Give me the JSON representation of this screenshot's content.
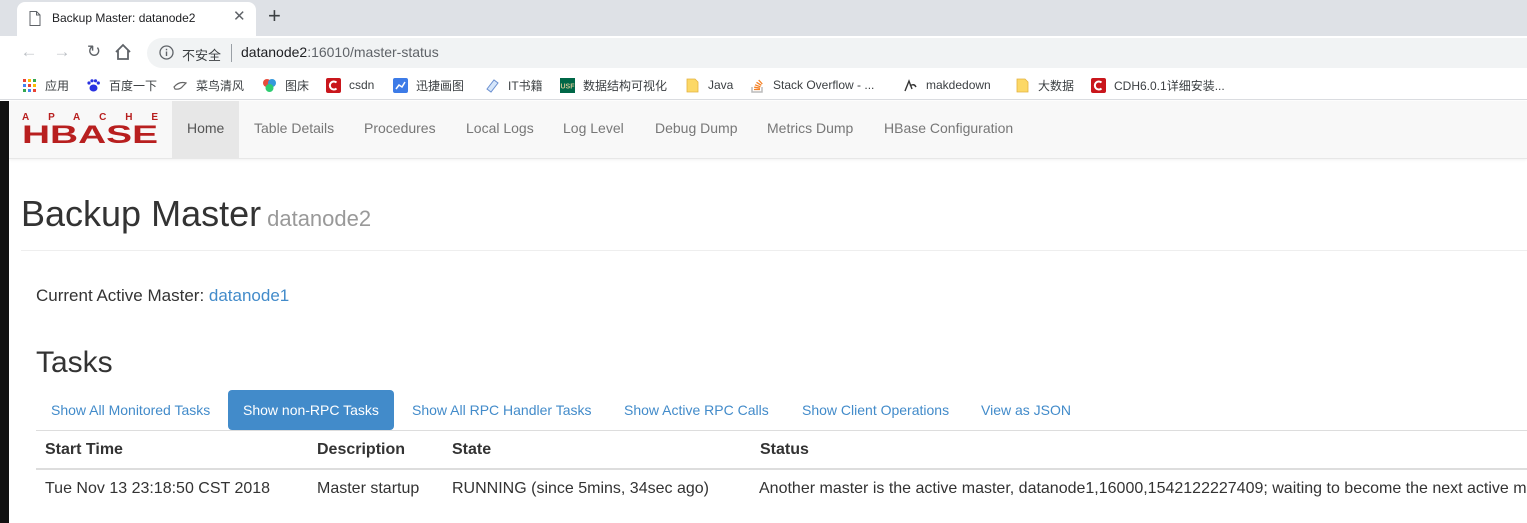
{
  "browser": {
    "tab_title": "Backup Master: datanode2",
    "insecure_label": "不安全",
    "url_host": "datanode2",
    "url_rest": ":16010/master-status",
    "bookmarks": [
      {
        "label": "应用",
        "icon": "apps-grid-icon"
      },
      {
        "label": "百度一下",
        "icon": "baidu-paw-icon"
      },
      {
        "label": "菜鸟清风",
        "icon": "bird-icon"
      },
      {
        "label": "图床",
        "icon": "image-bed-icon"
      },
      {
        "label": "csdn",
        "icon": "csdn-icon"
      },
      {
        "label": "迅捷画图",
        "icon": "xunjie-icon"
      },
      {
        "label": "IT书籍",
        "icon": "book-icon"
      },
      {
        "label": "数据结构可视化",
        "icon": "usf-icon"
      },
      {
        "label": "Java",
        "icon": "folder-icon"
      },
      {
        "label": "Stack Overflow - ...",
        "icon": "stackoverflow-icon"
      },
      {
        "label": "makdedown",
        "icon": "markdown-icon"
      },
      {
        "label": "大数据",
        "icon": "folder-icon"
      },
      {
        "label": "CDH6.0.1详细安装...",
        "icon": "csdn-icon"
      }
    ]
  },
  "navbar": {
    "logo_top": "APACHE",
    "logo_main": "HBASE",
    "items": [
      "Home",
      "Table Details",
      "Procedures",
      "Local Logs",
      "Log Level",
      "Debug Dump",
      "Metrics Dump",
      "HBase Configuration"
    ]
  },
  "page": {
    "title": "Backup Master",
    "subtitle": "datanode2",
    "current_label": "Current Active Master: ",
    "current_master": "datanode1",
    "tasks_heading": "Tasks"
  },
  "task_filters": [
    "Show All Monitored Tasks",
    "Show non-RPC Tasks",
    "Show All RPC Handler Tasks",
    "Show Active RPC Calls",
    "Show Client Operations",
    "View as JSON"
  ],
  "table": {
    "headers": [
      "Start Time",
      "Description",
      "State",
      "Status"
    ],
    "rows": [
      [
        "Tue Nov 13 23:18:50 CST 2018",
        "Master startup",
        "RUNNING (since 5mins, 34sec ago)",
        "Another master is the active master, datanode1,16000,1542122227409; waiting to become the next active m"
      ]
    ]
  },
  "colors": {
    "link": "#428bca",
    "hbase_red": "#b81f1f"
  }
}
